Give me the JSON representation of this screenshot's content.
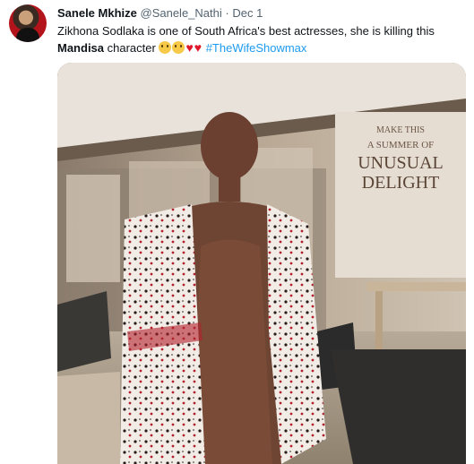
{
  "tweet": {
    "author_name": "Sanele Mkhize",
    "author_handle": "@Sanele_Nathi",
    "separator": "·",
    "date": "Dec 1",
    "text_part1": "Zikhona Sodlaka is one of South Africa's best actresses, she is killing this ",
    "text_bold": "Mandisa",
    "text_part2": " character ",
    "hashtag": "#TheWifeShowmax",
    "emojis": [
      "smiling-face-icon",
      "smiling-face-icon",
      "red-heart-icon",
      "red-heart-icon"
    ]
  },
  "photo": {
    "wall_text_1": "MAKE THIS",
    "wall_text_2": "A SUMMER OF",
    "wall_text_3": "UNUSUAL",
    "wall_text_4": "DELIGHT"
  }
}
